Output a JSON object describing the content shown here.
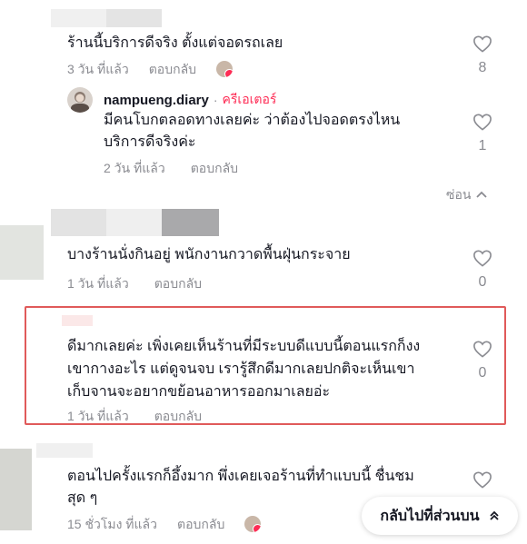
{
  "comments": [
    {
      "text": "ร้านนี้บริการดีจริง ตั้งแต่จอดรถเลย",
      "time": "3 วัน ที่แล้ว",
      "reply_label": "ตอบกลับ",
      "likes": "8",
      "reply": {
        "username": "nampueng.diary",
        "separator": "·",
        "badge": "ครีเอเตอร์",
        "line1": "มีคนโบกตลอดทางเลยค่ะ ว่าต้องไปจอดตรงไหน",
        "line2": "บริการดีจริงค่ะ",
        "time": "2 วัน ที่แล้ว",
        "reply_label": "ตอบกลับ",
        "likes": "1"
      },
      "hide_label": "ซ่อน"
    },
    {
      "text": "บางร้านนั่งกินอยู่ พนักงานกวาดพื้นฝุ่นกระจาย",
      "time": "1 วัน ที่แล้ว",
      "reply_label": "ตอบกลับ",
      "likes": "0"
    },
    {
      "line1": "ดีมากเลยค่ะ เพิ่งเคยเห็นร้านที่มีระบบดีแบบนี้ตอนแรกก็งง",
      "line2": "เขากางอะไร แต่ดูจนจบ เรารู้สึกดีมากเลยปกติจะเห็นเขา",
      "line3": "เก็บจานจะอยากขย้อนอาหารออกมาเลยอ่ะ",
      "time": "1 วัน ที่แล้ว",
      "reply_label": "ตอบกลับ",
      "likes": "0"
    },
    {
      "line1": "ตอนไปครั้งแรกก็อึ้งมาก พึ่งเคยเจอร้านที่ทำแบบนี้ ชื่นชม",
      "line2": "สุด ๆ",
      "time": "15 ชั่วโมง ที่แล้ว",
      "reply_label": "ตอบกลับ"
    }
  ],
  "back_to_top": {
    "label": "กลับไปที่ส่วนบน",
    "icon": "chevrons-up-icon"
  },
  "colors": {
    "accent": "#fe2c55",
    "highlight": "#e05a5a",
    "muted": "#8a8b91"
  }
}
